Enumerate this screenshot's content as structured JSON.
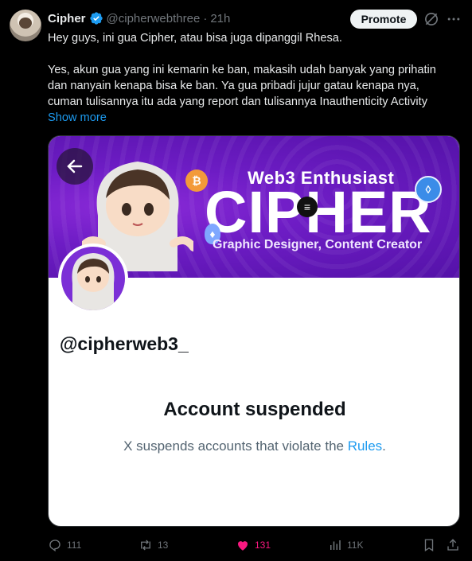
{
  "author": {
    "name": "Cipher",
    "handle": "@cipherwebthree",
    "separator": "·",
    "time": "21h"
  },
  "promote_label": "Promote",
  "tweet": {
    "line1": "Hey guys, ini gua Cipher, atau bisa juga dipanggil Rhesa.",
    "line2": "Yes, akun gua yang ini kemarin ke ban, makasih udah banyak yang prihatin",
    "line3": "dan nanyain kenapa bisa ke ban. Ya gua pribadi jujur gatau kenapa nya,",
    "line4": "cuman tulisannya itu ada yang report dan tulisannya Inauthenticity Activity",
    "show_more": "Show more"
  },
  "card": {
    "banner_subtitle": "Web3 Enthusiast",
    "banner_title": "CIPHER",
    "banner_tagline": "Graphic Designer, Content Creator",
    "profile_handle": "@cipherweb3_",
    "suspended_title": "Account suspended",
    "suspended_text_prefix": "X suspends accounts that violate the ",
    "suspended_link": "Rules",
    "suspended_text_suffix": "."
  },
  "stats": {
    "replies": "111",
    "reposts": "13",
    "likes": "131",
    "views": "11K"
  },
  "colors": {
    "background": "#000000",
    "accent": "#1d9bf0",
    "like": "#f91880",
    "banner": "#6d1cc4"
  }
}
